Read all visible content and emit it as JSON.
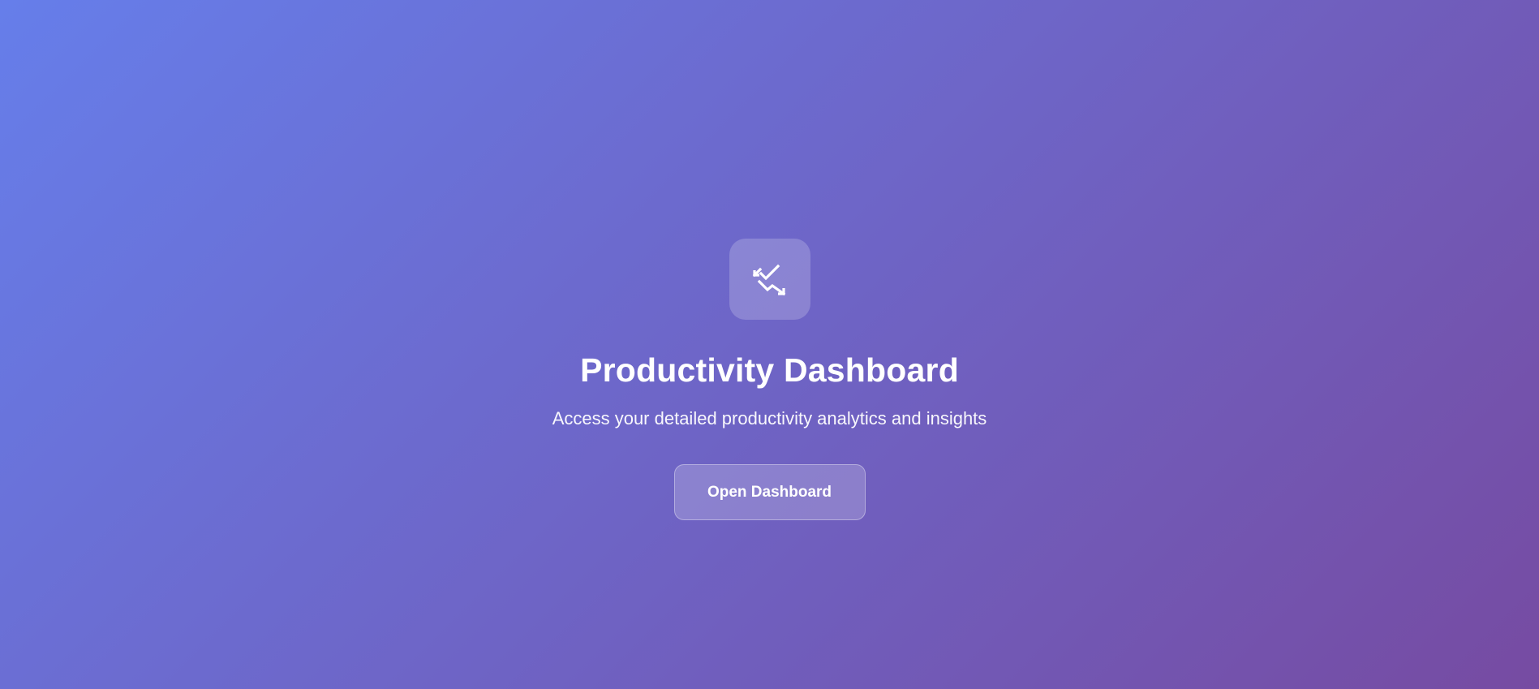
{
  "hero": {
    "icon": "chart-line-icon",
    "title": "Productivity Dashboard",
    "subtitle": "Access your detailed productivity analytics and insights",
    "button_label": "Open Dashboard"
  },
  "colors": {
    "gradient_start": "#667eea",
    "gradient_end": "#764ba2",
    "text": "#ffffff"
  }
}
